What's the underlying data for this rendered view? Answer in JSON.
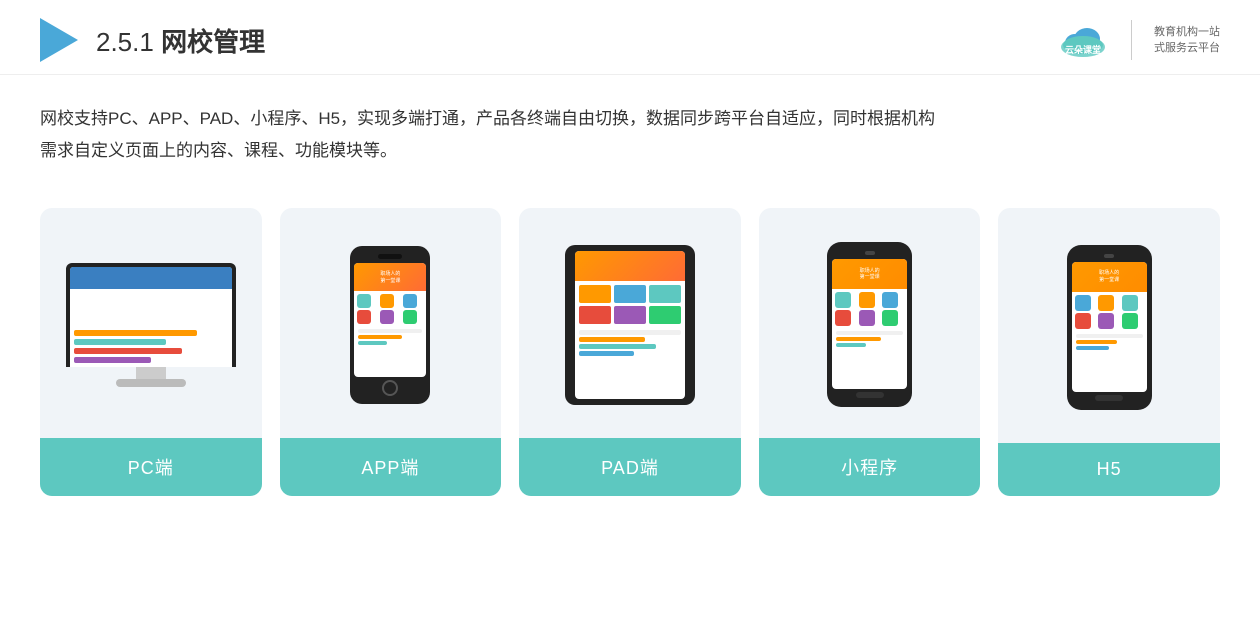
{
  "header": {
    "section_number": "2.5.1",
    "title_plain": "",
    "title_bold": "网校管理",
    "logo_url": "yunduoketang.com",
    "logo_name": "云朵课堂",
    "logo_slogan_line1": "教育机构一站",
    "logo_slogan_line2": "式服务云平台"
  },
  "description": {
    "line1": "网校支持PC、APP、PAD、小程序、H5，实现多端打通，产品各终端自由切换，数据同步跨平台自适应，同时根据机构",
    "line2": "需求自定义页面上的内容、课程、功能模块等。"
  },
  "cards": [
    {
      "id": "pc",
      "label": "PC端"
    },
    {
      "id": "app",
      "label": "APP端"
    },
    {
      "id": "pad",
      "label": "PAD端"
    },
    {
      "id": "miniprogram",
      "label": "小程序"
    },
    {
      "id": "h5",
      "label": "H5"
    }
  ]
}
